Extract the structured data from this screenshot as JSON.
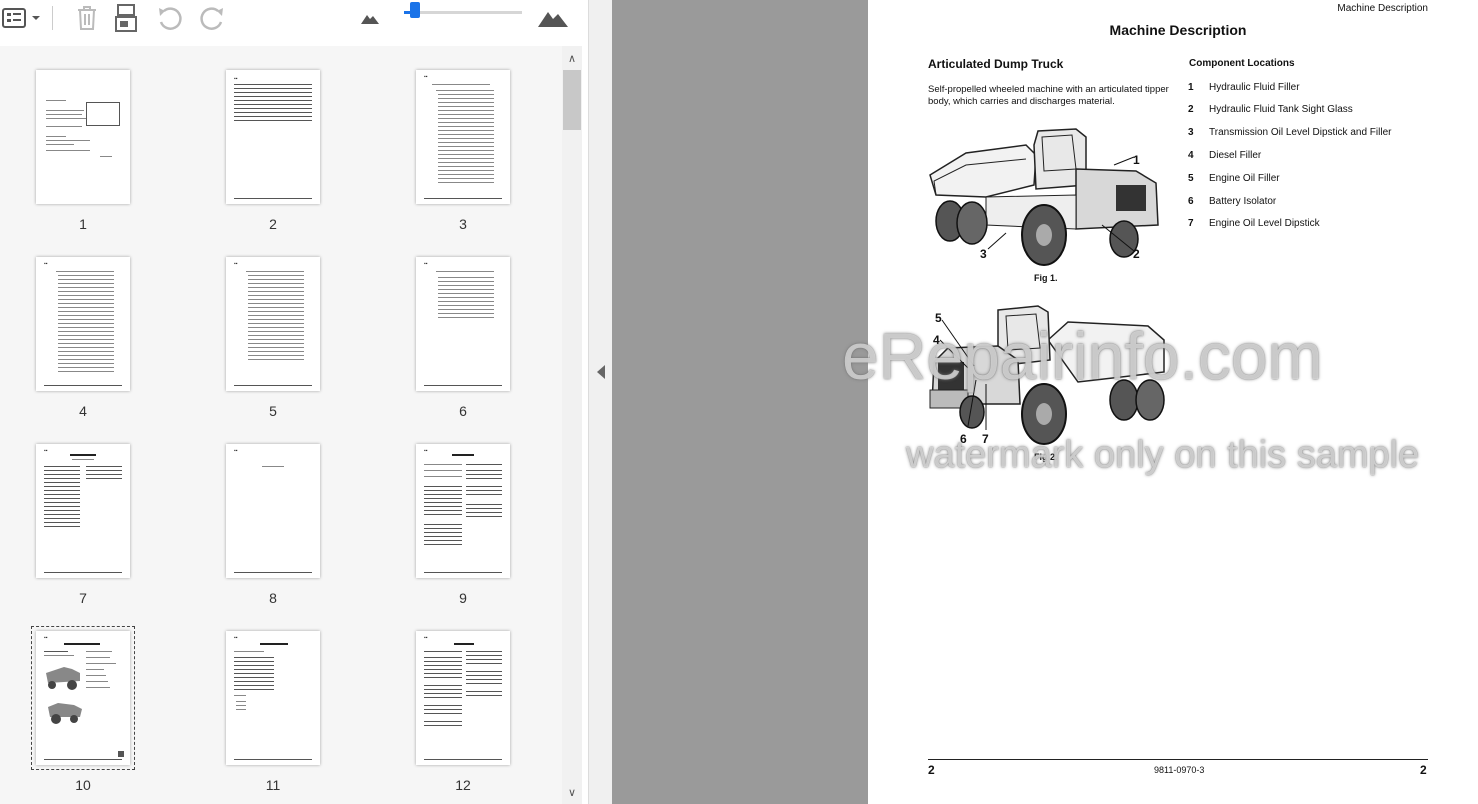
{
  "toolbar": {
    "view_icon": "thumbnail-list-icon",
    "dropdown_icon": "chevron-down-icon",
    "delete_icon": "trash-icon",
    "save_icon": "save-pages-icon",
    "rotate_left_icon": "rotate-counterclockwise-icon",
    "rotate_right_icon": "rotate-clockwise-icon",
    "zoom_out_icon": "small-mountain-icon",
    "zoom_in_icon": "large-mountain-icon",
    "zoom_level": 0.05
  },
  "thumbnails": [
    {
      "label": "1"
    },
    {
      "label": "2"
    },
    {
      "label": "3"
    },
    {
      "label": "4"
    },
    {
      "label": "5"
    },
    {
      "label": "6"
    },
    {
      "label": "7"
    },
    {
      "label": "8"
    },
    {
      "label": "9"
    },
    {
      "label": "10"
    },
    {
      "label": "11"
    },
    {
      "label": "12"
    }
  ],
  "selected_thumbnail": "10",
  "document": {
    "header_right": "Machine Description",
    "title": "Machine Description",
    "section_title": "Articulated Dump Truck",
    "description": "Self-propelled wheeled machine with an articulated tipper body, which carries and discharges material.",
    "component_heading": "Component Locations",
    "components": [
      {
        "num": "1",
        "label": "Hydraulic Fluid Filler"
      },
      {
        "num": "2",
        "label": "Hydraulic Fluid Tank Sight Glass"
      },
      {
        "num": "3",
        "label": "Transmission Oil Level Dipstick and Filler"
      },
      {
        "num": "4",
        "label": "Diesel Filler"
      },
      {
        "num": "5",
        "label": "Engine Oil Filler"
      },
      {
        "num": "6",
        "label": "Battery Isolator"
      },
      {
        "num": "7",
        "label": "Engine Oil Level Dipstick"
      }
    ],
    "fig1_caption": "Fig 1.",
    "fig2_caption": "Fig 2.",
    "fig1_callouts": [
      "1",
      "2",
      "3"
    ],
    "fig2_callouts": [
      "5",
      "4",
      "6",
      "7"
    ],
    "footer_left": "2",
    "footer_center": "9811-0970-3",
    "footer_right": "2"
  },
  "watermark": {
    "line1": "eRepairinfo.com",
    "line2": "watermark only on this sample"
  }
}
